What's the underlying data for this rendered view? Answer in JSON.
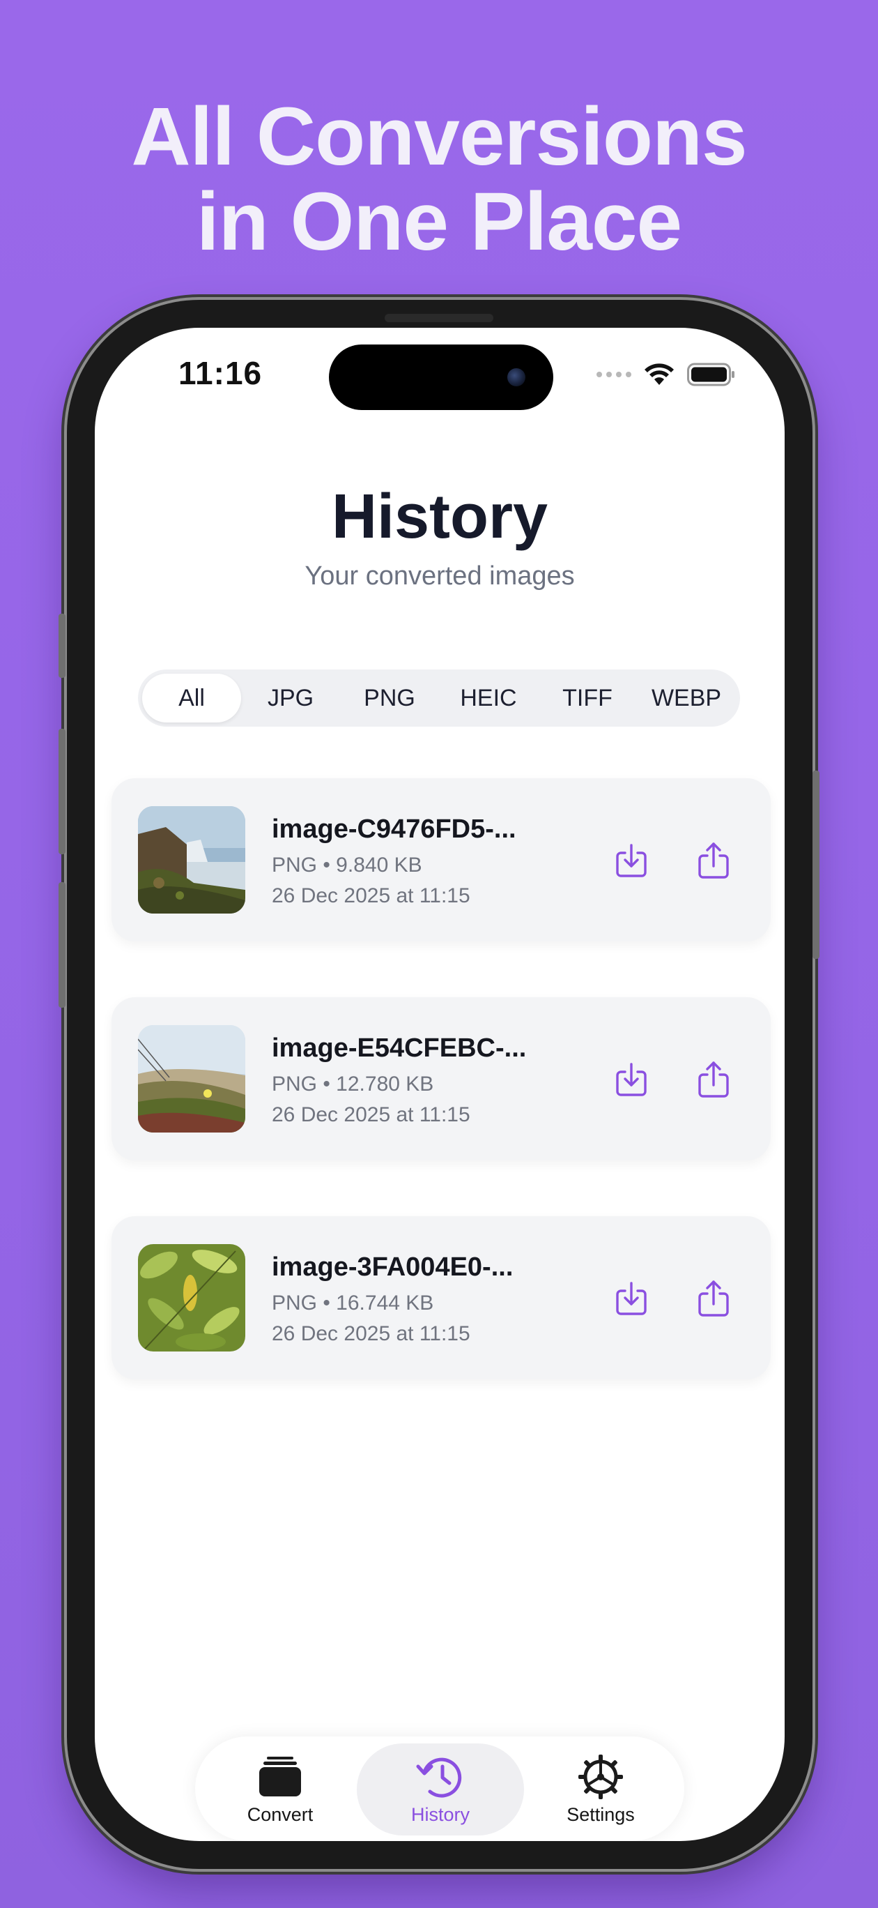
{
  "promo": {
    "headline_line1": "All Conversions",
    "headline_line2": "in One Place"
  },
  "status_bar": {
    "time": "11:16"
  },
  "header": {
    "title": "History",
    "subtitle": "Your converted images"
  },
  "filters": {
    "selected": "All",
    "items": [
      "All",
      "JPG",
      "PNG",
      "HEIC",
      "TIFF",
      "WEBP"
    ]
  },
  "history": [
    {
      "name": "image-C9476FD5-...",
      "meta": "PNG • 9.840 KB",
      "date": "26 Dec 2025 at 11:15",
      "thumb_icon": "waterfall-photo"
    },
    {
      "name": "image-E54CFEBC-...",
      "meta": "PNG • 12.780 KB",
      "date": "26 Dec 2025 at 11:15",
      "thumb_icon": "beach-dunes-photo"
    },
    {
      "name": "image-3FA004E0-...",
      "meta": "PNG • 16.744 KB",
      "date": "26 Dec 2025 at 11:15",
      "thumb_icon": "leaves-photo"
    }
  ],
  "tabbar": {
    "active": "History",
    "tabs": [
      {
        "label": "Convert",
        "icon": "stack-icon"
      },
      {
        "label": "History",
        "icon": "history-clock-icon"
      },
      {
        "label": "Settings",
        "icon": "gear-icon"
      }
    ]
  },
  "colors": {
    "background": "#9a68ea",
    "accent": "#8a4fe0",
    "card": "#f3f4f6",
    "title": "#161a2b"
  }
}
